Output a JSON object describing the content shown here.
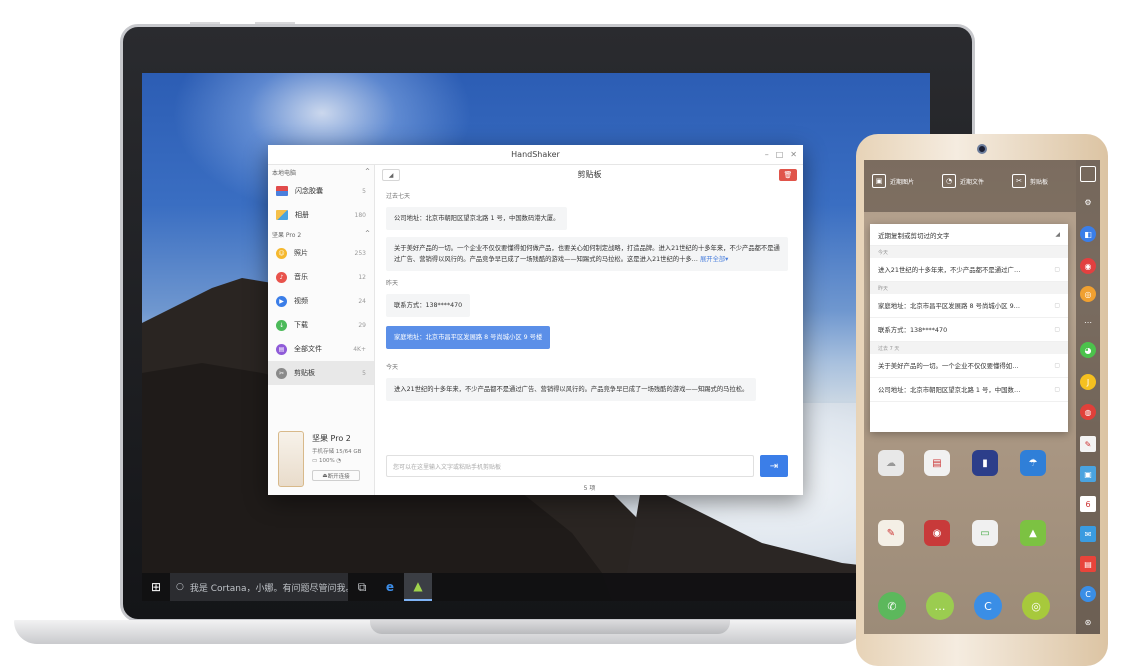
{
  "window": {
    "title": "HandShaker"
  },
  "sidebar": {
    "local_title": "本地电脑",
    "local_items": [
      {
        "label": "闪念胶囊",
        "count": "5"
      },
      {
        "label": "相册",
        "count": "180"
      }
    ],
    "device_title": "坚果 Pro 2",
    "device_items": [
      {
        "label": "照片",
        "count": "253"
      },
      {
        "label": "音乐",
        "count": "12"
      },
      {
        "label": "视频",
        "count": "24"
      },
      {
        "label": "下载",
        "count": "29"
      },
      {
        "label": "全部文件",
        "count": "4K+"
      },
      {
        "label": "剪贴板",
        "count": "5"
      }
    ],
    "device": {
      "name": "坚果 Pro 2",
      "storage": "手机存储 15/64 GB",
      "battery": "100%",
      "disconnect": "断开连接"
    }
  },
  "main": {
    "title": "剪贴板",
    "groups": [
      {
        "label": "过去七天",
        "items": [
          "公司地址：北京市朝阳区望京北路 1 号，中国数码港大厦。",
          "关于美好产品的一切。一个企业不仅仅要懂得如何做产品，也要关心如何制定战略，打造品牌。进入21世纪的十多年来，不少产品都不是通过广告、营销得以风行的。产品竞争早已成了一场残酷的游戏——知踢式的马拉松。这是进入21世纪的十多…"
        ],
        "expand_label": "展开全部"
      },
      {
        "label": "昨天",
        "items": [
          "联系方式：138****470",
          "家庭地址：北京市昌平区发展路 8 号尚城小区 9 号楼"
        ]
      },
      {
        "label": "今天",
        "items": [
          "进入21世纪的十多年来，不少产品都不是通过广告、营销得以风行的。产品竞争早已成了一场残酷的游戏——知踢式的马拉松。"
        ]
      }
    ],
    "input_placeholder": "您可以在这里输入文字或粘贴手机剪贴板",
    "count": "5 项"
  },
  "taskbar": {
    "search": "我是 Cortana，小娜。有问题尽管问我。"
  },
  "phone": {
    "tiles": [
      "近期图片",
      "近期文件",
      "剪贴板"
    ],
    "panel_title": "近期复制或剪切过的文字",
    "panel_groups": [
      {
        "label": "今天",
        "items": [
          "进入21世纪的十多年来，不少产品都不是通过广…"
        ]
      },
      {
        "label": "昨天",
        "items": [
          "家庭地址：北京市昌平区发展路 8 号尚城小区 9…",
          "联系方式：138****470"
        ]
      },
      {
        "label": "过去 7 天",
        "items": [
          "关于美好产品的一切。一个企业不仅仅要懂得如…",
          "公司地址：北京市朝阳区望京北路 1 号，中国数…"
        ]
      }
    ]
  }
}
